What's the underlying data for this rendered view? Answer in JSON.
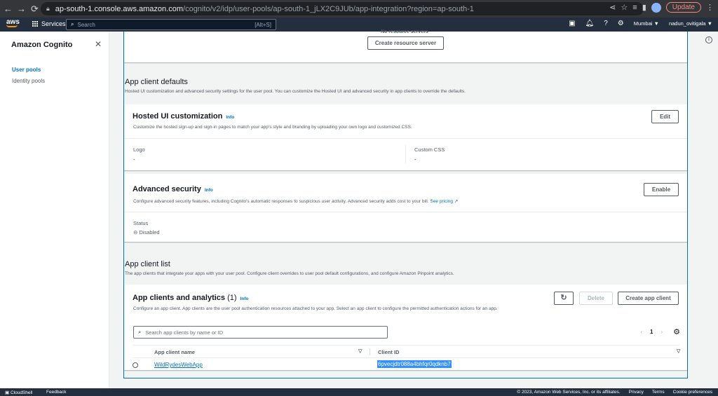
{
  "browser": {
    "host": "ap-south-1.console.aws.amazon.com",
    "path": "/cognito/v2/idp/user-pools/ap-south-1_jLX2C9JUb/app-integration?region=ap-south-1",
    "update_label": "Update"
  },
  "aws_header": {
    "logo_text": "aws",
    "services_label": "Services",
    "search_placeholder": "Search",
    "search_shortcut": "[Alt+S]",
    "region": "Mumbai ▼",
    "user": "nadun_ovitigala ▼"
  },
  "sidebar": {
    "title": "Amazon Cognito",
    "items": [
      {
        "label": "User pools",
        "active": true
      },
      {
        "label": "Identity pools",
        "active": false
      }
    ]
  },
  "resource_server": {
    "empty_text": "No resource servers",
    "create_button": "Create resource server"
  },
  "app_client_defaults": {
    "title": "App client defaults",
    "description": "Hosted UI customization and advanced security settings for the user pool. You can customize the Hosted UI and advanced security in app clients to override the defaults."
  },
  "hosted_ui": {
    "title": "Hosted UI customization",
    "info": "Info",
    "description": "Customize the hosted sign-up and sign-in pages to match your app's style and branding by uploading your own logo and customized CSS.",
    "edit_button": "Edit",
    "logo_label": "Logo",
    "logo_value": "-",
    "css_label": "Custom CSS",
    "css_value": "-"
  },
  "advanced_security": {
    "title": "Advanced security",
    "info": "Info",
    "description": "Configure advanced security features, including Cognito's automatic responses to suspicious user activity. Advanced security adds cost to your bill.",
    "pricing_link": "See pricing",
    "enable_button": "Enable",
    "status_label": "Status",
    "status_value": "Disabled"
  },
  "app_client_list": {
    "title": "App client list",
    "description": "The app clients that integrate your apps with your user pool. Configure client overrides to user pool default configurations, and configure Amazon Pinpoint analytics."
  },
  "app_clients": {
    "title": "App clients and analytics",
    "count": "(1)",
    "info": "Info",
    "description": "Configure an app client. App clients are the user pool authentication resources attached to your app. Select an app client to configure the permitted authentication actions for an app.",
    "delete_button": "Delete",
    "create_button": "Create app client",
    "search_placeholder": "Search app clients by name or ID",
    "page_number": "1",
    "columns": [
      "App client name",
      "Client ID"
    ],
    "rows": [
      {
        "name": "WildRydesWebApp",
        "client_id": "6pvecjdtr088a4bhfqr0qdknb7"
      }
    ]
  },
  "footer": {
    "cloudshell": "CloudShell",
    "feedback": "Feedback",
    "copyright": "© 2023, Amazon Web Services, Inc. or its affiliates.",
    "privacy": "Privacy",
    "terms": "Terms",
    "cookie": "Cookie preferences"
  }
}
